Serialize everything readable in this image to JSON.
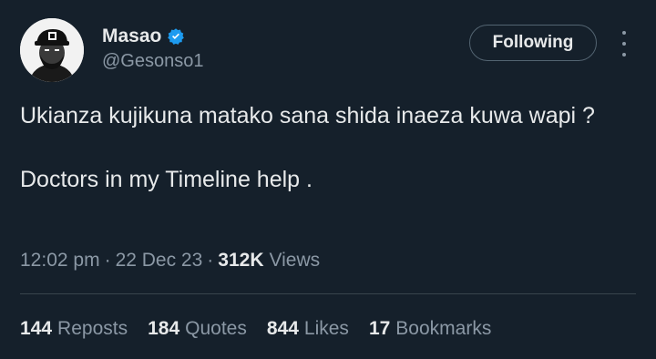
{
  "author": {
    "display_name": "Masao",
    "handle": "@Gesonso1",
    "verified": true,
    "verified_color": "#1d9bf0",
    "avatar_icon": "cartoon-man-with-cap-avatar"
  },
  "follow_button": {
    "label": "Following"
  },
  "more_menu": {
    "icon": "more-vertical-icon"
  },
  "tweet": {
    "line1": "Ukianza kujikuna matako sana shida inaeza kuwa wapi ?",
    "line2": "Doctors in my Timeline help ."
  },
  "meta": {
    "time": "12:02 pm",
    "date": "22 Dec 23",
    "views_count": "312K",
    "views_label": "Views",
    "separator": "·"
  },
  "stats": {
    "reposts_count": "144",
    "reposts_label": "Reposts",
    "quotes_count": "184",
    "quotes_label": "Quotes",
    "likes_count": "844",
    "likes_label": "Likes",
    "bookmarks_count": "17",
    "bookmarks_label": "Bookmarks"
  },
  "colors": {
    "background": "#15202b",
    "primary_text": "#e7e9ea",
    "secondary_text": "#8b98a5",
    "divider": "#38444d"
  }
}
